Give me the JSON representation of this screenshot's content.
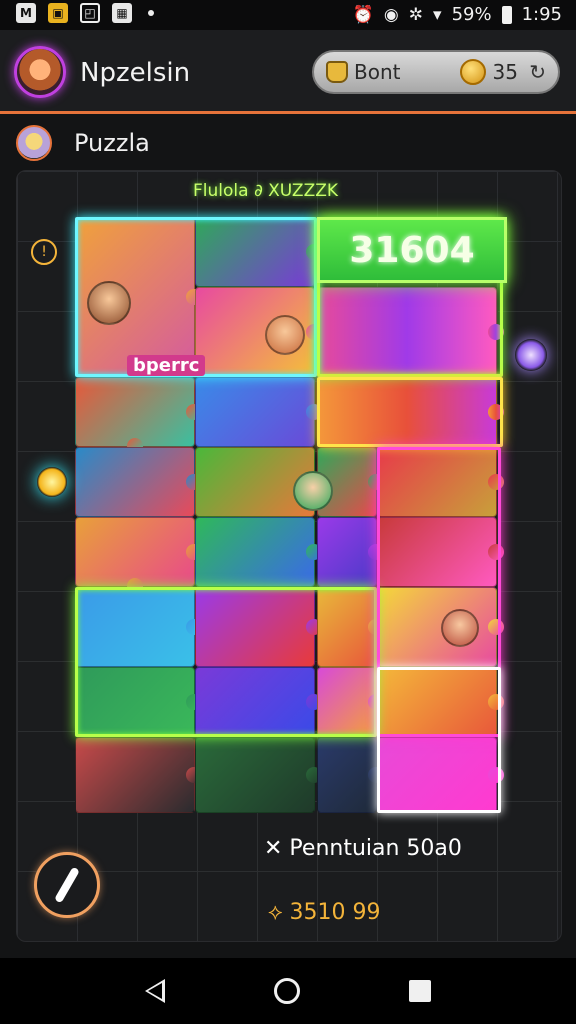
{
  "status_bar": {
    "left_icons": [
      "notification-icon",
      "gallery-icon",
      "clipboard-icon",
      "image-icon",
      "dot-icon"
    ],
    "icon_glyphs": {
      "notification": "M",
      "gallery": "▣",
      "clipboard": "◰",
      "image": "▦"
    },
    "alarm_glyph": "⏰",
    "focus_glyph": "◉",
    "vibrate_glyph": "✲",
    "wifi_glyph": "▾",
    "battery_text": "59%",
    "time": "1:95"
  },
  "header": {
    "title": "Npzelsin",
    "pill_label": "Bont",
    "coins": "35",
    "refresh_glyph": "↻"
  },
  "subheader": {
    "title": "Puzzla"
  },
  "board": {
    "heading": "Flulola ∂ XUZZZK",
    "score": "31604",
    "timer_glyph": "!",
    "piece_label": "bperrc"
  },
  "footer": {
    "info_line_1": "✕ Penntuian 50a0",
    "info_line_2": "⟡ 3510 99"
  },
  "nav": {
    "back": "back",
    "home": "home",
    "recents": "recents"
  },
  "colors": {
    "accent_orange": "#e6733a",
    "neon_lime": "#b8ff4a",
    "neon_cyan": "#6ff7ff",
    "neon_pink": "#ff4ad8",
    "score_green": "#4cd93e"
  }
}
